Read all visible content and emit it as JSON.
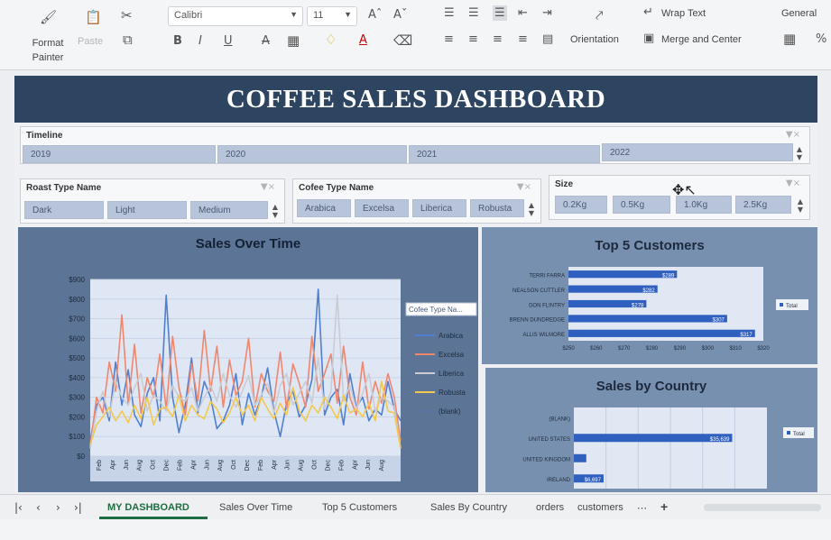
{
  "ribbon": {
    "format_painter_label": "Format Painter",
    "paste_label": "Paste",
    "font_name": "Calibri",
    "font_size": "11",
    "bold": "B",
    "italic": "I",
    "underline": "U",
    "orientation_label": "Orientation",
    "wrap_text_label": "Wrap Text",
    "merge_center_label": "Merge and Center",
    "number_format": "General"
  },
  "dashboard": {
    "title": "COFFEE SALES DASHBOARD",
    "timeline": {
      "title": "Timeline",
      "years": [
        "2019",
        "2020",
        "2021",
        "2022"
      ]
    },
    "roast_slicer": {
      "title": "Roast Type Name",
      "items": [
        "Dark",
        "Light",
        "Medium"
      ]
    },
    "coffee_slicer": {
      "title": "Cofee Type Name",
      "items": [
        "Arabica",
        "Excelsa",
        "Liberica",
        "Robusta"
      ]
    },
    "size_slicer": {
      "title": "Size",
      "items": [
        "0.2Kg",
        "0.5Kg",
        "1.0Kg",
        "2.5Kg"
      ]
    }
  },
  "colors": {
    "banner": "#2d4560",
    "panel": "#5c7597",
    "plot_bg": "#dfe7f5",
    "chip": "#b7c4d9",
    "bar": "#2f5fbf",
    "active_tab": "#1f6e43"
  },
  "chart_data": [
    {
      "type": "line",
      "title": "Sales Over Time",
      "legend_title": "Cofee Type Na...",
      "legend_position": "right",
      "ylim": [
        0,
        900
      ],
      "y_ticks": [
        "$0",
        "$100",
        "$200",
        "$300",
        "$400",
        "$500",
        "$600",
        "$700",
        "$800",
        "$900"
      ],
      "x_tick_labels": [
        "Feb",
        "Apr",
        "Jun",
        "Aug",
        "Oct",
        "Dec",
        "Feb",
        "Apr",
        "Jun",
        "Aug",
        "Oct",
        "Dec",
        "Feb",
        "Apr",
        "Jun",
        "Aug",
        "Oct",
        "Dec",
        "Feb",
        "Apr",
        "Jun",
        "Aug"
      ],
      "series": [
        {
          "name": "Arabica",
          "color": "#4f7fd0",
          "values": [
            80,
            260,
            300,
            180,
            480,
            260,
            440,
            210,
            150,
            320,
            400,
            180,
            820,
            300,
            120,
            260,
            500,
            220,
            380,
            300,
            140,
            180,
            260,
            420,
            160,
            320,
            210,
            300,
            450,
            230,
            100,
            270,
            330,
            200,
            260,
            390,
            850,
            210,
            300,
            340,
            160,
            420,
            250,
            300,
            180,
            240,
            210,
            380,
            240,
            180
          ]
        },
        {
          "name": "Excelsa",
          "color": "#f0876d",
          "values": [
            50,
            300,
            220,
            480,
            330,
            720,
            260,
            570,
            220,
            400,
            300,
            520,
            240,
            610,
            350,
            210,
            470,
            280,
            640,
            330,
            560,
            250,
            490,
            310,
            380,
            600,
            250,
            420,
            330,
            280,
            530,
            240,
            470,
            370,
            250,
            610,
            330,
            420,
            520,
            270,
            560,
            300,
            210,
            480,
            240,
            380,
            270,
            420,
            300,
            80
          ]
        },
        {
          "name": "Liberica",
          "color": "#c9ccd3",
          "values": [
            40,
            230,
            330,
            200,
            380,
            300,
            260,
            350,
            420,
            230,
            310,
            280,
            230,
            360,
            300,
            280,
            350,
            230,
            300,
            360,
            280,
            420,
            310,
            250,
            330,
            410,
            260,
            310,
            370,
            220,
            360,
            420,
            260,
            320,
            380,
            270,
            500,
            240,
            330,
            820,
            280,
            360,
            240,
            320,
            420,
            230,
            300,
            280,
            250,
            40
          ]
        },
        {
          "name": "Robusta",
          "color": "#f2c94c",
          "values": [
            60,
            160,
            200,
            250,
            180,
            230,
            170,
            260,
            190,
            300,
            160,
            240,
            250,
            200,
            310,
            180,
            260,
            210,
            190,
            280,
            240,
            170,
            220,
            300,
            210,
            260,
            180,
            300,
            240,
            190,
            270,
            210,
            350,
            230,
            180,
            260,
            220,
            300,
            250,
            190,
            310,
            220,
            240,
            200,
            270,
            180,
            380,
            230,
            220,
            40
          ]
        },
        {
          "name": "(blank)",
          "color": "#5b6fa0",
          "values": []
        }
      ]
    },
    {
      "type": "bar",
      "title": "Top 5 Customers",
      "legend": "Total",
      "legend_position": "right",
      "categories": [
        "TERRI FARRA",
        "NEALSON CUTTLER",
        "DON FLINTRY",
        "BRENN DUNDREDGE",
        "ALLIS WILMORE"
      ],
      "values": [
        289,
        282,
        278,
        307,
        317
      ],
      "data_labels": [
        "$289",
        "$282",
        "$278",
        "$307",
        "$317"
      ],
      "x_ticks": [
        "$250",
        "$260",
        "$270",
        "$280",
        "$290",
        "$300",
        "$310",
        "$320"
      ],
      "xlim": [
        250,
        320
      ]
    },
    {
      "type": "bar",
      "title": "Sales by Country",
      "legend": "Total",
      "legend_position": "right",
      "categories": [
        "(BLANK)",
        "UNITED STATES",
        "UNITED KINGDOM",
        "IRELAND"
      ],
      "values": [
        0,
        35639,
        2798,
        6697
      ],
      "data_labels": [
        "",
        "$35,639",
        "",
        "$6,697"
      ]
    }
  ],
  "sheet_tabs": {
    "tabs": [
      "MY DASHBOARD",
      "Sales Over Time",
      "Top 5 Customers",
      "Sales By Country",
      "orders",
      "customers"
    ],
    "more": "⋯",
    "add": "+"
  }
}
